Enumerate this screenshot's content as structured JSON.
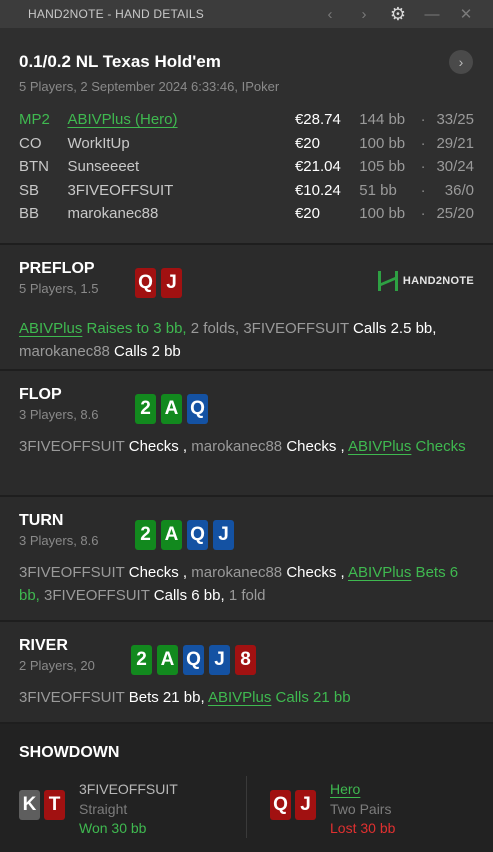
{
  "window": {
    "title": "HAND2NOTE - HAND DETAILS",
    "icons": [
      "chevron-left-icon",
      "chevron-right-icon",
      "gear-icon",
      "minimize-icon",
      "close-icon"
    ]
  },
  "header": {
    "title": "0.1/0.2 NL Texas Hold'em",
    "subtitle": "5 Players, 2 September 2024 6:33:46, IPoker",
    "players": [
      {
        "pos": "MP2",
        "name": "ABIVPlus (Hero)",
        "stack": "€28.74",
        "bb": "144 bb",
        "sep": "·",
        "ratio": "33/25",
        "hero": true
      },
      {
        "pos": "CO",
        "name": "WorkItUp",
        "stack": "€20",
        "bb": "100 bb",
        "sep": "·",
        "ratio": "29/21"
      },
      {
        "pos": "BTN",
        "name": "Sunseeeet",
        "stack": "€21.04",
        "bb": "105 bb",
        "sep": "·",
        "ratio": "30/24"
      },
      {
        "pos": "SB",
        "name": "3FIVEOFFSUIT",
        "stack": "€10.24",
        "bb": "51 bb",
        "sep": "·",
        "ratio": "36/0"
      },
      {
        "pos": "BB",
        "name": "marokanec88",
        "stack": "€20",
        "bb": "100 bb",
        "sep": "·",
        "ratio": "25/20"
      }
    ]
  },
  "preflop": {
    "title": "PREFLOP",
    "sub": "5 Players, 1.5",
    "cards": [
      {
        "r": "Q",
        "c": "#a11111"
      },
      {
        "r": "J",
        "c": "#a11111"
      }
    ],
    "logo": "HAND2NOTE",
    "a1": "ABIVPlus",
    "a2": " Raises to 3 bb, ",
    "a3": "2 folds, ",
    "a4": "3FIVEOFFSUIT",
    "a5": " Calls 2.5 bb, ",
    "a6": "marokanec88",
    "a7": " Calls 2 bb"
  },
  "flop": {
    "title": "FLOP",
    "sub": "3 Players, 8.6",
    "cards": [
      {
        "r": "2",
        "c": "#12891e"
      },
      {
        "r": "A",
        "c": "#12891e"
      },
      {
        "r": "Q",
        "c": "#1452a3"
      }
    ],
    "a1": "3FIVEOFFSUIT",
    "a2": " Checks , ",
    "a3": "marokanec88",
    "a4": " Checks , ",
    "a5": "ABIVPlus",
    "a6": " Checks"
  },
  "turn": {
    "title": "TURN",
    "sub": "3 Players, 8.6",
    "cards": [
      {
        "r": "2",
        "c": "#12891e"
      },
      {
        "r": "A",
        "c": "#12891e"
      },
      {
        "r": "Q",
        "c": "#1452a3"
      },
      {
        "r": "J",
        "c": "#1452a3"
      }
    ],
    "a1": "3FIVEOFFSUIT",
    "a2": " Checks , ",
    "a3": "marokanec88",
    "a4": " Checks , ",
    "a5": "ABIVPlus",
    "a6": " Bets 6 bb, ",
    "a7": "3FIVEOFFSUIT",
    "a8": " Calls 6 bb, ",
    "a9": "1 fold"
  },
  "river": {
    "title": "RIVER",
    "sub": "2 Players, 20",
    "cards": [
      {
        "r": "2",
        "c": "#12891e"
      },
      {
        "r": "A",
        "c": "#12891e"
      },
      {
        "r": "Q",
        "c": "#1452a3"
      },
      {
        "r": "J",
        "c": "#1452a3"
      },
      {
        "r": "8",
        "c": "#a11111"
      }
    ],
    "a1": "3FIVEOFFSUIT",
    "a2": " Bets 21 bb, ",
    "a3": "ABIVPlus",
    "a4": " Calls 21 bb"
  },
  "showdown": {
    "title": "SHOWDOWN",
    "p1": {
      "cards": [
        {
          "r": "K",
          "c": "#5e5e5e"
        },
        {
          "r": "T",
          "c": "#a11111"
        }
      ],
      "name": "3FIVEOFFSUIT",
      "hand": "Straight",
      "result": "Won 30 bb"
    },
    "p2": {
      "cards": [
        {
          "r": "Q",
          "c": "#a11111"
        },
        {
          "r": "J",
          "c": "#a11111"
        }
      ],
      "name": "Hero",
      "hand": "Two Pairs",
      "result": "Lost 30 bb"
    }
  }
}
